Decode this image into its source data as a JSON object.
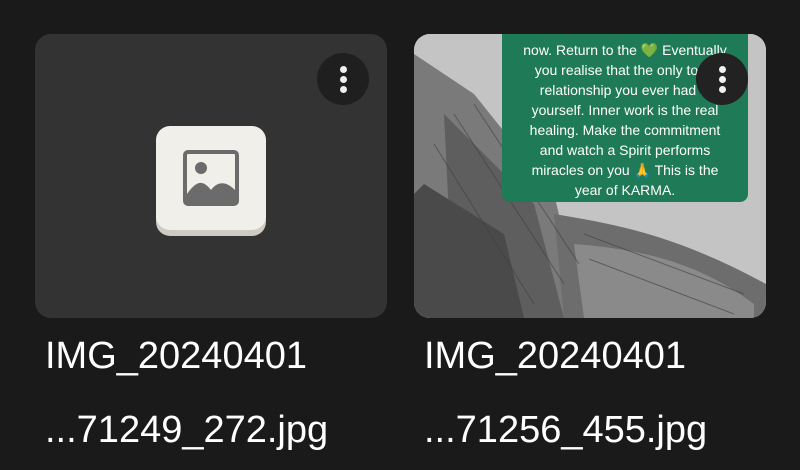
{
  "files": [
    {
      "name_line1": "IMG_20240401",
      "name_line2": "...71249_272.jpg",
      "thumbnail": "image-placeholder-icon",
      "menu_icon": "more-vert-icon"
    },
    {
      "name_line1": "IMG_20240401",
      "name_line2": "...71256_455.jpg",
      "thumbnail": "photo",
      "menu_icon": "more-vert-icon",
      "photo_text": {
        "line1": "now. Return to the",
        "heart": "💚",
        "line1b": "Eventually",
        "line2": "you realise that the only toxic",
        "line3": "relationship you ever had is",
        "line4": "yourself. Inner work is the real",
        "line5": "healing. Make the commitment",
        "line6": "and watch a Spirit performs",
        "line7": "miracles on you 🙏 This is the",
        "line8": "year of KARMA."
      }
    }
  ],
  "colors": {
    "background": "#1a1a1a",
    "tile_background": "#333333",
    "note_green": "#1f7a57"
  }
}
